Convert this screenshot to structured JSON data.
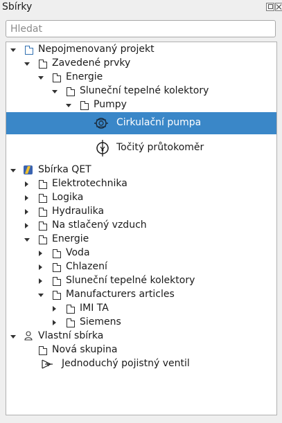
{
  "panel": {
    "title": "Sbírky"
  },
  "search": {
    "placeholder": "Hledat",
    "value": ""
  },
  "tree": {
    "project": {
      "label": "Nepojmenovaný projekt",
      "imported": "Zavedené prvky",
      "energie": "Energie",
      "solar": "Sluneční tepelné kolektory",
      "pumpy": "Pumpy",
      "pump_item": "Cirkulační pumpa",
      "flowmeter_item": "Točitý průtokoměr"
    },
    "qet": {
      "label": "Sbírka QET",
      "items": [
        "Elektrotechnika",
        "Logika",
        "Hydraulika",
        "Na stlačený vzduch",
        "Energie"
      ],
      "energie_children": [
        "Voda",
        "Chlazení",
        "Sluneční tepelné kolektory",
        "Manufacturers articles"
      ],
      "manufacturers_children": [
        "IMI TA",
        "Siemens"
      ]
    },
    "custom": {
      "label": "Vlastní sbírka",
      "group": "Nová skupina",
      "valve": "Jednoduchý pojistný ventil"
    }
  },
  "colors": {
    "selection": "#3a87c8",
    "project_icon": "#2f6fb0",
    "qet_icon": "#3a63b0"
  }
}
